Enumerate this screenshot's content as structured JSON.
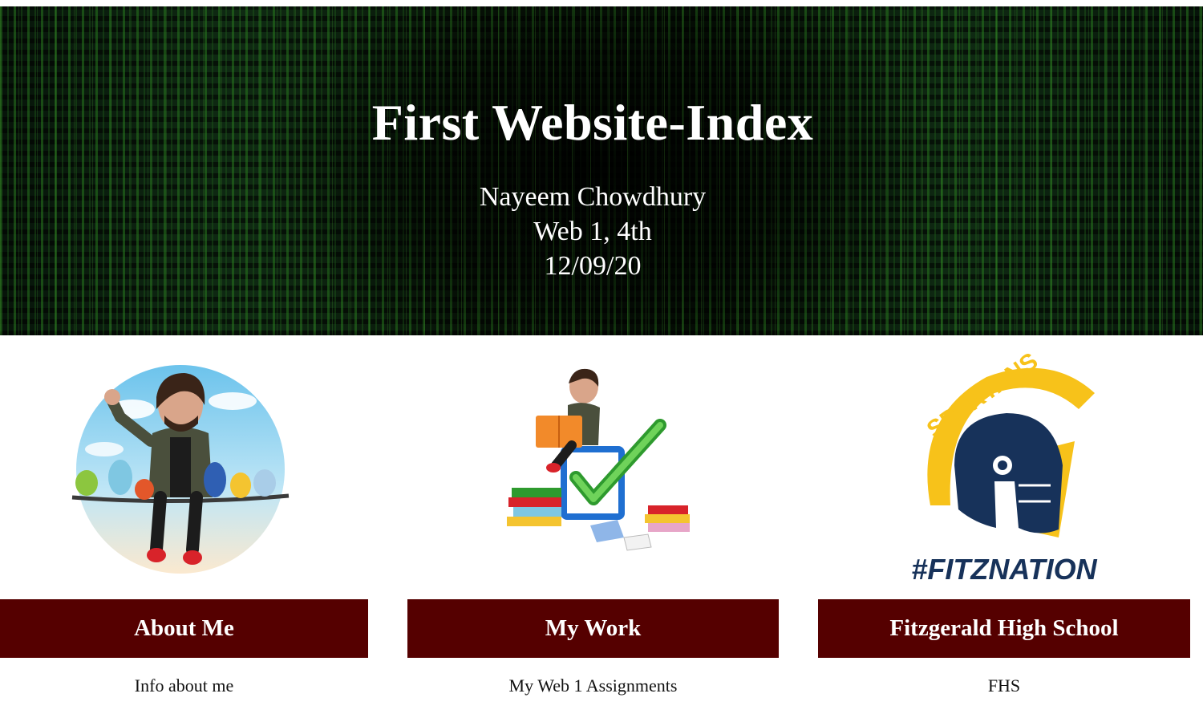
{
  "header": {
    "title": "First Website-Index",
    "lines": [
      "Nayeem Chowdhury",
      "Web 1, 4th",
      "12/09/20"
    ]
  },
  "cards": [
    {
      "button": "About Me",
      "description": "Info about me"
    },
    {
      "button": "My Work",
      "description": "My Web 1 Assignments"
    },
    {
      "button": "Fitzgerald High School",
      "description": "FHS",
      "logo_text": "SPARTANS",
      "logo_tag": "#FITZNATION"
    }
  ],
  "colors": {
    "button_bg": "#550000",
    "button_text": "#ffffff",
    "hero_text": "#ffffff",
    "logo_yellow": "#f7c21a",
    "logo_navy": "#17325a"
  },
  "icons": {
    "card1": "waving-avatar-on-branch-with-birds-icon",
    "card2": "reading-avatar-with-checkmark-and-books-icon",
    "card3": "spartan-helmet-logo-icon"
  }
}
